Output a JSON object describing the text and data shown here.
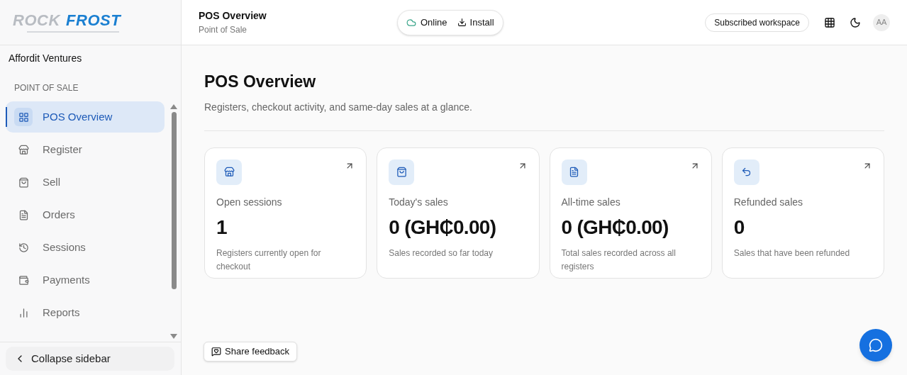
{
  "logo": {
    "word_1": "ROCK",
    "word_2": "FROST"
  },
  "sidebar": {
    "workspace": "Affordit Ventures",
    "section": "POINT OF SALE",
    "items": [
      {
        "label": "POS Overview",
        "selected": true
      },
      {
        "label": "Register",
        "selected": false
      },
      {
        "label": "Sell",
        "selected": false
      },
      {
        "label": "Orders",
        "selected": false
      },
      {
        "label": "Sessions",
        "selected": false
      },
      {
        "label": "Payments",
        "selected": false
      },
      {
        "label": "Reports",
        "selected": false
      }
    ],
    "collapse": "Collapse sidebar"
  },
  "header": {
    "title": "POS Overview",
    "subtitle": "Point of Sale",
    "status": "Online",
    "install": "Install",
    "plan": "Subscribed workspace",
    "avatar": "AA"
  },
  "page": {
    "title": "POS Overview",
    "description": "Registers, checkout activity, and same-day sales at a glance."
  },
  "cards": [
    {
      "label": "Open sessions",
      "value": "1",
      "note": "Registers currently open for checkout"
    },
    {
      "label": "Today's sales",
      "value": "0 (GH₵0.00)",
      "note": "Sales recorded so far today"
    },
    {
      "label": "All-time sales",
      "value": "0 (GH₵0.00)",
      "note": "Total sales recorded across all registers"
    },
    {
      "label": "Refunded sales",
      "value": "0",
      "note": "Sales that have been refunded"
    }
  ],
  "feedback": "Share feedback"
}
